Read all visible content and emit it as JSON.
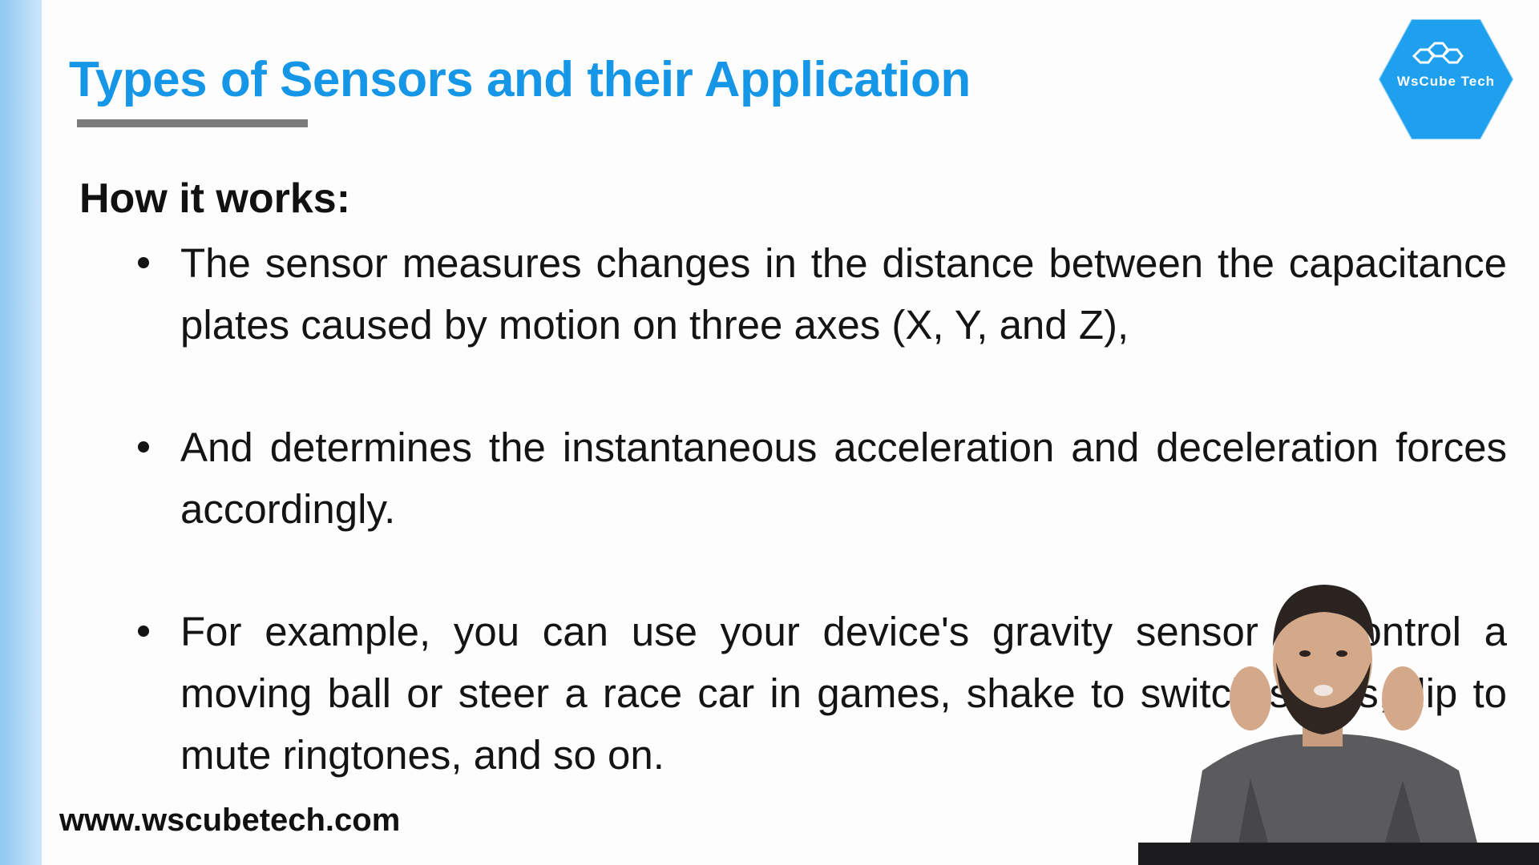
{
  "slide": {
    "title": "Types of Sensors and their Application",
    "heading": "How it works:",
    "bullets": [
      "The sensor measures changes in the distance between the capacitance plates caused by motion on three axes (X, Y, and Z),",
      "And determines the instantaneous acceleration and deceleration forces accordingly.",
      "For example, you can use your device's gravity sensor to control a moving ball or steer a race car in games, shake to switch songs, flip to mute ringtones, and so on."
    ],
    "website": "www.wscubetech.com"
  },
  "logo": {
    "text": "WsCube Tech",
    "icon": "honeycomb-logo-icon",
    "color": "#1696e6"
  },
  "presenter": {
    "icon": "presenter-video-overlay"
  },
  "colors": {
    "title": "#1696e6",
    "accent_bar": "#8fc8f0",
    "underline": "#7c7c7c",
    "text": "#141414"
  }
}
